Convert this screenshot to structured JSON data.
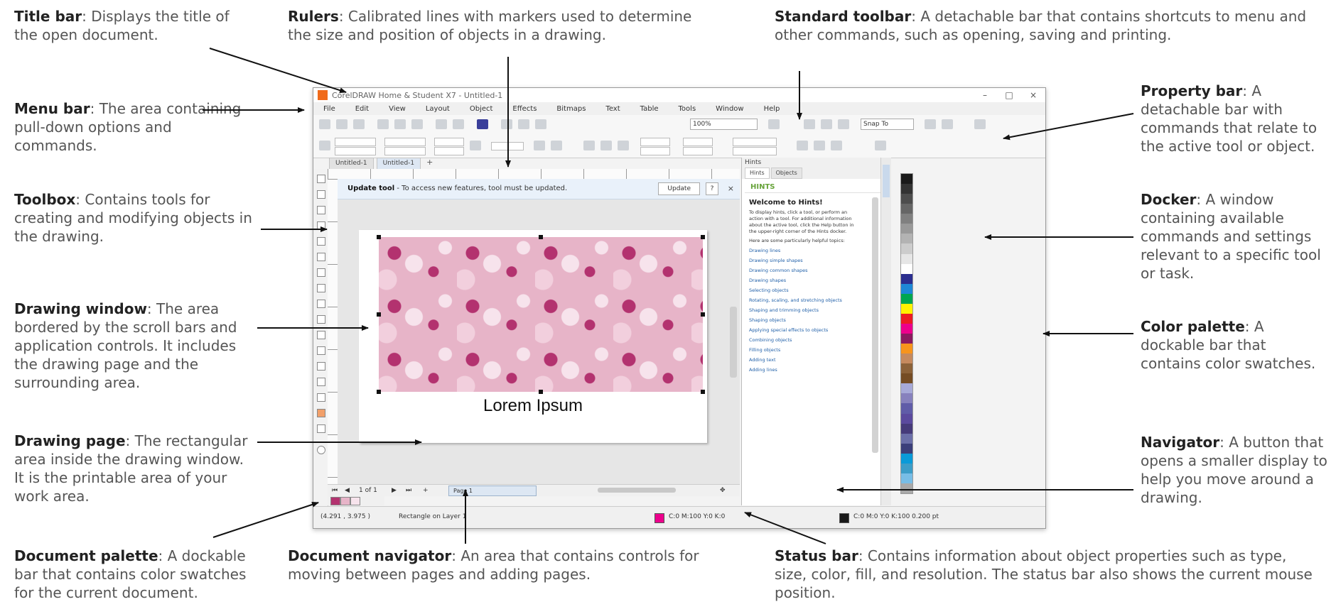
{
  "callouts": {
    "title_bar": {
      "term": "Title bar",
      "desc": ": Displays the title of the open document."
    },
    "rulers": {
      "term": "Rulers",
      "desc": ": Calibrated lines with markers used to determine the size and position of objects in a drawing."
    },
    "standard_toolbar": {
      "term": "Standard toolbar",
      "desc": ": A detachable bar that contains shortcuts to menu and other commands, such as opening, saving and printing."
    },
    "menu_bar": {
      "term": "Menu bar",
      "desc": ": The area containing pull-down options and commands."
    },
    "property_bar": {
      "term": "Property bar",
      "desc": ": A detachable bar with commands that relate to the active tool or object."
    },
    "toolbox": {
      "term": "Toolbox",
      "desc": ": Contains tools for creating and modifying objects in the drawing."
    },
    "docker": {
      "term": "Docker",
      "desc": ": A window containing available commands and settings relevant to a specific tool or task."
    },
    "drawing_window": {
      "term": "Drawing window",
      "desc": ": The area bordered by the scroll bars and application controls. It includes the drawing page and the surrounding area."
    },
    "color_palette": {
      "term": "Color palette",
      "desc": ": A dockable bar that contains color swatches."
    },
    "drawing_page": {
      "term": "Drawing page",
      "desc": ": The rectangular area inside the drawing window. It is the printable area of your work area."
    },
    "navigator": {
      "term": "Navigator",
      "desc": ": A button that opens a smaller display to help you move around a drawing."
    },
    "document_palette": {
      "term": "Document palette",
      "desc": ": A dockable bar that contains color swatches for the current document."
    },
    "document_navigator": {
      "term": "Document navigator",
      "desc": ": An area that contains controls for moving between pages and adding pages."
    },
    "status_bar": {
      "term": "Status bar",
      "desc": ": Contains information about object properties such as type, size, color, fill, and resolution. The status bar also shows the current mouse position."
    }
  },
  "app": {
    "title": "CorelDRAW Home & Student X7 - Untitled-1",
    "menu": [
      "File",
      "Edit",
      "View",
      "Layout",
      "Object",
      "Effects",
      "Bitmaps",
      "Text",
      "Table",
      "Tools",
      "Window",
      "Help"
    ],
    "zoom": "100%",
    "snap_to": "Snap To",
    "tabs": [
      "Untitled-1",
      "Untitled-1"
    ],
    "update_bar": {
      "strong": "Update tool",
      "text": " - To access new features, tool must be updated.",
      "button": "Update",
      "help": "?",
      "close": "×"
    },
    "lorem": "Lorem Ipsum",
    "doc_nav": {
      "counter": "1 of 1",
      "page_tab": "Page 1"
    },
    "status": {
      "coords": "(4.291 , 3.975 )",
      "layer": "Rectangle on Layer 1",
      "fill_info": "C:0 M:100 Y:0 K:0",
      "outline_info": "C:0 M:0 Y:0 K:100  0.200 pt"
    },
    "docker": {
      "title": "Hints",
      "tabs": [
        "Hints",
        "Objects"
      ],
      "heading": "HINTS",
      "welcome": "Welcome to Hints!",
      "para1": "To display hints, click a tool, or perform an action with a tool. For additional information about the active tool, click the Help button in the upper-right corner of the Hints docker.",
      "para2": "Here are some particularly helpful topics:",
      "links": [
        "Drawing lines",
        "Drawing simple shapes",
        "Drawing common shapes",
        "Drawing shapes",
        "Selecting objects",
        "Rotating, scaling, and stretching objects",
        "Shaping and trimming objects",
        "Shaping objects",
        "Applying special effects to objects",
        "Combining objects",
        "Filling objects",
        "Adding text",
        "Adding lines"
      ]
    },
    "palette_colors": [
      "#1a1a1a",
      "#333333",
      "#4d4d4d",
      "#666666",
      "#808080",
      "#999999",
      "#b3b3b3",
      "#cccccc",
      "#e6e6e6",
      "#ffffff",
      "#2b2e8f",
      "#1e88d6",
      "#00a650",
      "#fff200",
      "#ed1c24",
      "#ec008c",
      "#8b1a5f",
      "#f7941d",
      "#c68a5e",
      "#8c6239",
      "#754c24",
      "#a7a9d8",
      "#8781bd",
      "#605ca8",
      "#5b4a9e",
      "#463b7a",
      "#6b6fa8",
      "#3b3f7a",
      "#0a9ad8",
      "#3c9dc8",
      "#78bde6",
      "#a9a9a9"
    ],
    "doc_palette_colors": [
      "#b3326f",
      "#e7b4c8",
      "#f7e3ec"
    ],
    "fill_color": "#ec008c",
    "outline_color": "#1a1a1a"
  }
}
